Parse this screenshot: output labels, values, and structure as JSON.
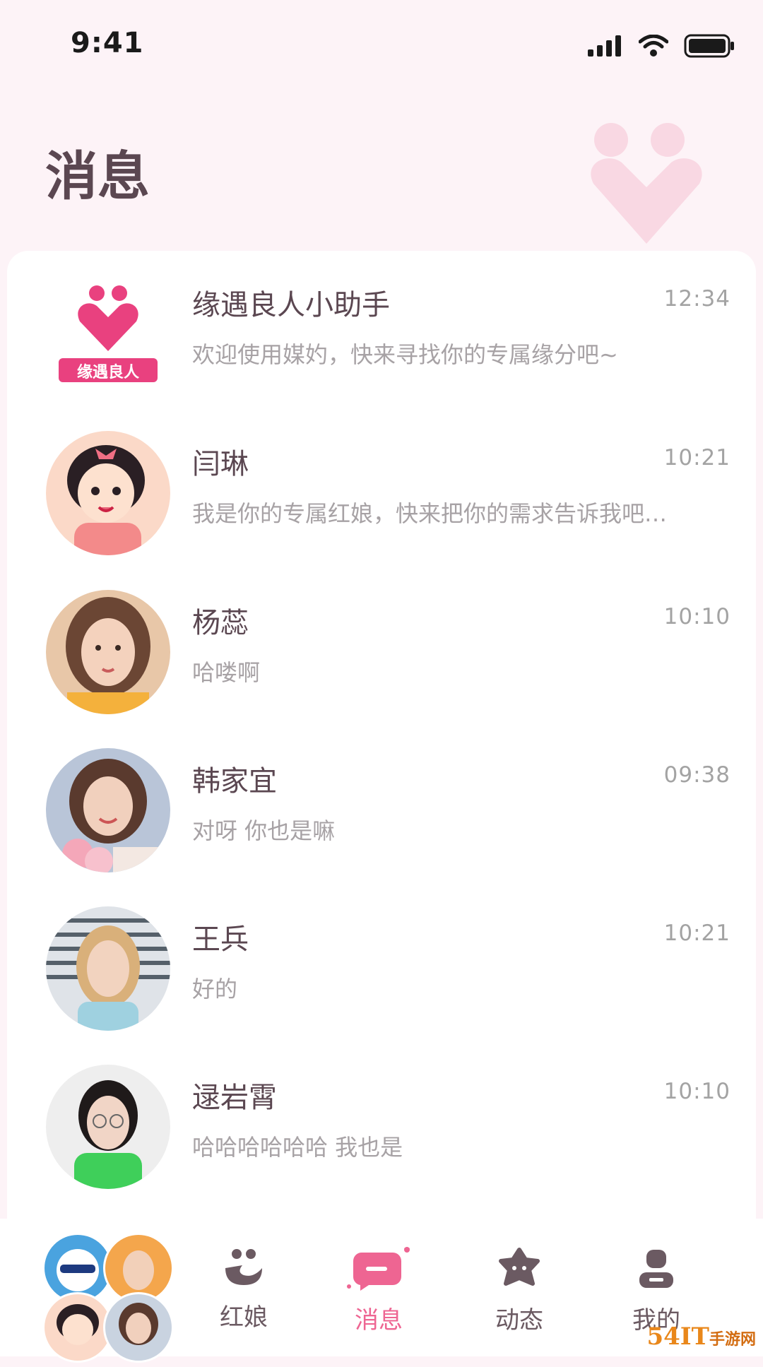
{
  "status_bar": {
    "time": "9:41"
  },
  "header": {
    "title": "消息"
  },
  "chats": [
    {
      "name": "缘遇良人小助手",
      "time": "12:34",
      "preview": "欢迎使用媒妁，快来寻找你的专属缘分吧~",
      "avatar_text": "缘遇良人"
    },
    {
      "name": "闫琳",
      "time": "10:21",
      "preview": "我是你的专属红娘，快来把你的需求告诉我吧…"
    },
    {
      "name": "杨蕊",
      "time": "10:10",
      "preview": "哈喽啊"
    },
    {
      "name": "韩家宜",
      "time": "09:38",
      "preview": "对呀 你也是嘛"
    },
    {
      "name": "王兵",
      "time": "10:21",
      "preview": "好的"
    },
    {
      "name": "逯岩霄",
      "time": "10:10",
      "preview": "哈哈哈哈哈哈 我也是"
    }
  ],
  "tabs": [
    {
      "label": "红娘",
      "icon": "matchmaker-icon"
    },
    {
      "label": "消息",
      "icon": "message-icon",
      "active": true
    },
    {
      "label": "动态",
      "icon": "moments-icon"
    },
    {
      "label": "我的",
      "icon": "profile-icon"
    }
  ],
  "watermark": {
    "text": "54IT",
    "sub": "手游网"
  },
  "colors": {
    "accent": "#ee6592",
    "background": "#fdf3f7",
    "title": "#5b4751"
  }
}
